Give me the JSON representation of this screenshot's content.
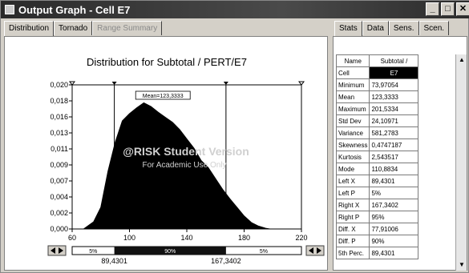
{
  "window": {
    "title": "Output Graph - Cell E7"
  },
  "left_tabs": [
    "Distribution",
    "Tornado",
    "Range Summary"
  ],
  "right_tabs": [
    "Stats",
    "Data",
    "Sens.",
    "Scen."
  ],
  "chart_data": {
    "type": "area",
    "title": "Distribution for Subtotal / PERT/E7",
    "x": [
      68,
      75,
      80,
      85,
      90,
      95,
      100,
      105,
      110,
      115,
      120,
      125,
      130,
      135,
      140,
      145,
      150,
      155,
      160,
      165,
      170,
      175,
      180,
      185,
      190,
      195,
      198
    ],
    "values": [
      0.0,
      0.001,
      0.003,
      0.008,
      0.012,
      0.015,
      0.016,
      0.0168,
      0.0175,
      0.017,
      0.0162,
      0.0155,
      0.0148,
      0.0138,
      0.0125,
      0.0112,
      0.0095,
      0.0085,
      0.007,
      0.0055,
      0.0042,
      0.003,
      0.0018,
      0.0009,
      0.0004,
      0.0001,
      0.0
    ],
    "xlim": [
      60,
      220
    ],
    "ylim": [
      0,
      0.02
    ],
    "xticks": [
      "60",
      "100",
      "140",
      "180",
      "220"
    ],
    "yticks": [
      "0,000",
      "0,002",
      "0,004",
      "0,007",
      "0,009",
      "0,011",
      "0,013",
      "0,016",
      "0,018",
      "0,020"
    ],
    "mean_label": "Mean=123,3333",
    "mean_value": 123.3333,
    "left_marker": 89.4301,
    "right_marker": 167.3402,
    "watermark_line1": "@RISK Student Version",
    "watermark_line2": "For Academic Use Only",
    "range_bar": {
      "left_pct": "5%",
      "center_pct": "90%",
      "right_pct": "5%",
      "left_value": "89,4301",
      "right_value": "167,3402"
    }
  },
  "stats": {
    "header_name": "Name",
    "header_value": "Subtotal /",
    "rows": [
      {
        "name": "Cell",
        "value": "E7"
      },
      {
        "name": "Minimum",
        "value": "73,97054"
      },
      {
        "name": "Mean",
        "value": "123,3333"
      },
      {
        "name": "Maximum",
        "value": "201,5334"
      },
      {
        "name": "Std Dev",
        "value": "24,10971"
      },
      {
        "name": "Variance",
        "value": "581,2783"
      },
      {
        "name": "Skewness",
        "value": "0,4747187"
      },
      {
        "name": "Kurtosis",
        "value": "2,543517"
      },
      {
        "name": "Mode",
        "value": "110,8834"
      },
      {
        "name": "Left X",
        "value": "89,4301"
      },
      {
        "name": "Left P",
        "value": "5%"
      },
      {
        "name": "Right X",
        "value": "167,3402"
      },
      {
        "name": "Right P",
        "value": "95%"
      },
      {
        "name": "Diff. X",
        "value": "77,91006"
      },
      {
        "name": "Diff. P",
        "value": "90%"
      },
      {
        "name": "5th Perc.",
        "value": "89,4301"
      }
    ]
  }
}
